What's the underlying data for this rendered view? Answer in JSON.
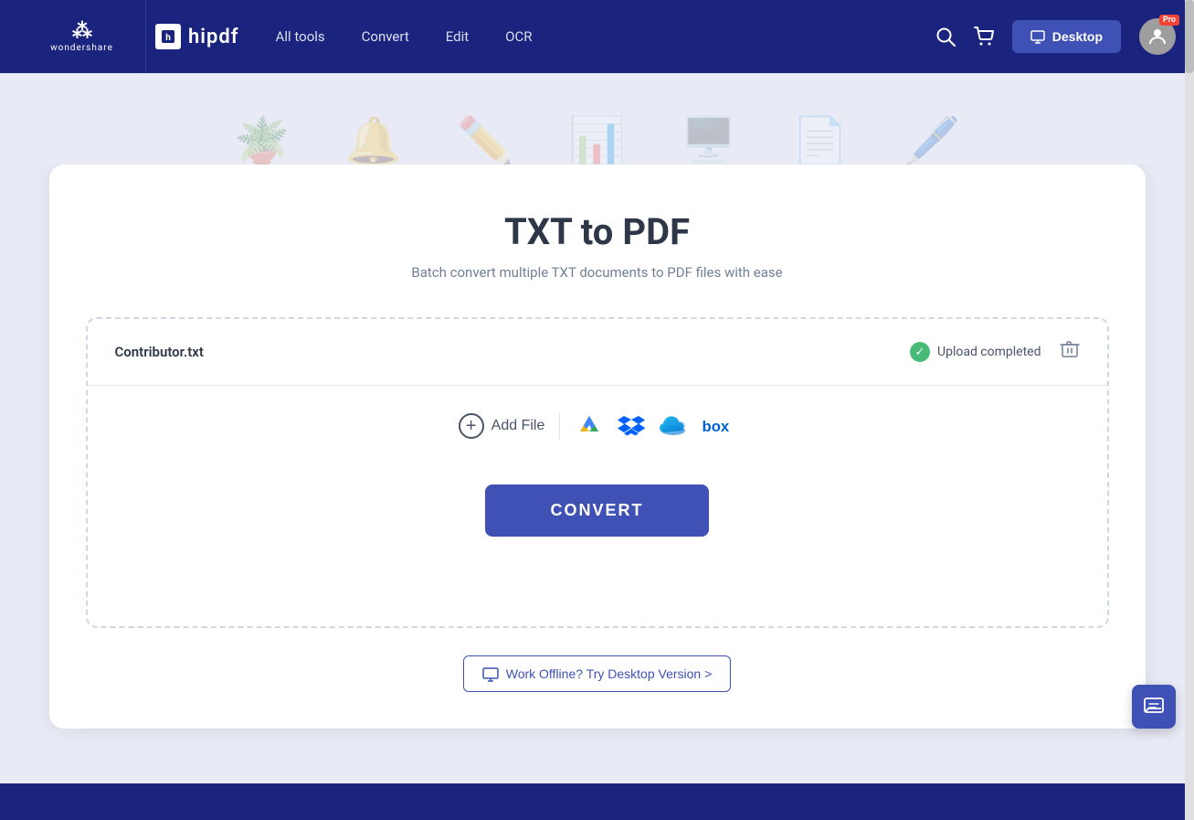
{
  "brand": {
    "wondershare": "wondershare",
    "ws_icon": "≋",
    "hipdf": "hipdf",
    "hipdf_icon": "≡"
  },
  "navbar": {
    "links": [
      {
        "label": "All tools",
        "id": "all-tools"
      },
      {
        "label": "Convert",
        "id": "convert"
      },
      {
        "label": "Edit",
        "id": "edit"
      },
      {
        "label": "OCR",
        "id": "ocr"
      }
    ],
    "desktop_btn": "Desktop",
    "pro_badge": "Pro"
  },
  "page": {
    "title": "TXT to PDF",
    "subtitle": "Batch convert multiple TXT documents to PDF files with ease"
  },
  "file": {
    "name": "Contributor.txt",
    "status": "Upload completed"
  },
  "actions": {
    "add_file": "Add File",
    "convert": "CONVERT",
    "offline": "Work Offline? Try Desktop Version >"
  }
}
